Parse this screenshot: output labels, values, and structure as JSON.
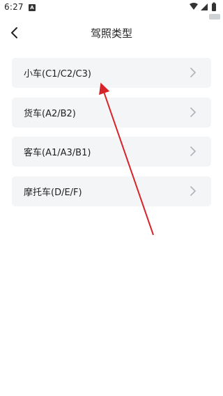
{
  "status": {
    "time": "6:27",
    "notification_badge": "A",
    "icons": [
      "wifi-icon",
      "signal-icon",
      "battery-icon"
    ]
  },
  "header": {
    "title": "驾照类型",
    "back_icon": "chevron-left-icon"
  },
  "license_types": [
    {
      "label": "小车(C1/C2/C3)"
    },
    {
      "label": "货车(A2/B2)"
    },
    {
      "label": "客车(A1/A3/B1)"
    },
    {
      "label": "摩托车(D/E/F)"
    }
  ],
  "colors": {
    "item_background": "#f4f5f7",
    "text": "#222222",
    "chevron": "#b0b3b8",
    "annotation_arrow": "#d8232a"
  }
}
